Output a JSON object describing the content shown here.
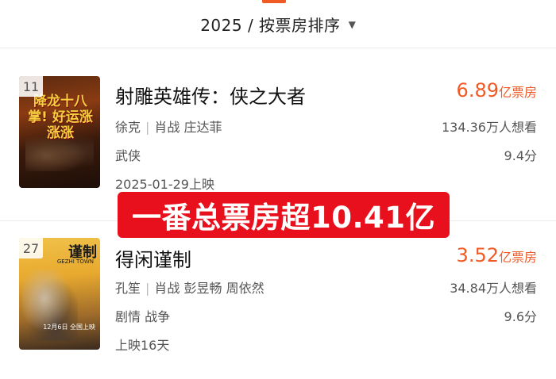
{
  "header": {
    "filter_label": "2025 / 按票房排序",
    "caret_glyph": "▼"
  },
  "movies": [
    {
      "rank": "11",
      "title": "射雕英雄传：侠之大者",
      "director": "徐克",
      "cast": "肖战 庄达菲",
      "genre": "武侠",
      "release": "2025-01-29上映",
      "box_value": "6.89",
      "box_unit": "亿票房",
      "want_to_see": "134.36万人想看",
      "score": "9.4分",
      "poster_slogan": "降龙十八掌! 好运涨涨涨"
    },
    {
      "rank": "27",
      "title": "得闲谨制",
      "director": "孔笙",
      "cast": "肖战 彭昱畅 周依然",
      "genre": "剧情 战争",
      "release": "上映16天",
      "box_value": "3.52",
      "box_unit": "亿票房",
      "want_to_see": "34.84万人想看",
      "score": "9.6分",
      "poster_logo": "谨制",
      "poster_sub": "GEZHI TOWN",
      "poster_date": "12月6日 全国上映"
    }
  ],
  "overlay_banner": "一番总票房超10.41亿",
  "colors": {
    "accent": "#f05a24",
    "banner": "#e8101c"
  }
}
